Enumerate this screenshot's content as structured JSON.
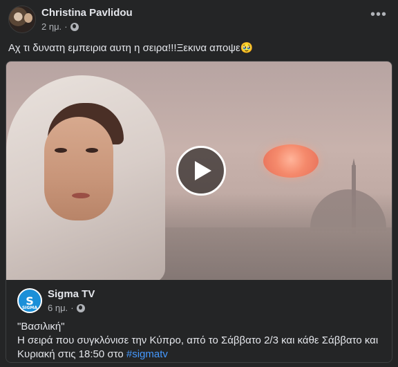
{
  "post": {
    "author": "Christina Pavlidou",
    "time": "2 ημ.",
    "separator": "·",
    "more_label": "•••",
    "text": "Αχ τι δυνατη εμπειρια αυτη η σειρα!!!Ξεκινα αποψε🥹"
  },
  "shared": {
    "page_name": "Sigma TV",
    "page_avatar_letter": "S",
    "page_avatar_caption": "SIGMA",
    "time": "6 ημ.",
    "separator": "·",
    "line1": "\"Βασιλική\"",
    "line2": "Η σειρά που συγκλόνισε την Κύπρο, από το Σάββατο 2/3 και κάθε Σάββατο και Κυριακή στις 18:50 στο",
    "hashtag": "#sigmatv"
  },
  "icons": {
    "globe": "globe-icon",
    "play": "play-icon",
    "more": "more-options-icon"
  },
  "colors": {
    "background": "#242526",
    "text": "#e4e6eb",
    "secondary_text": "#b0b3b8",
    "link": "#4599ff",
    "sigma_blue": "#1a8fd8"
  }
}
